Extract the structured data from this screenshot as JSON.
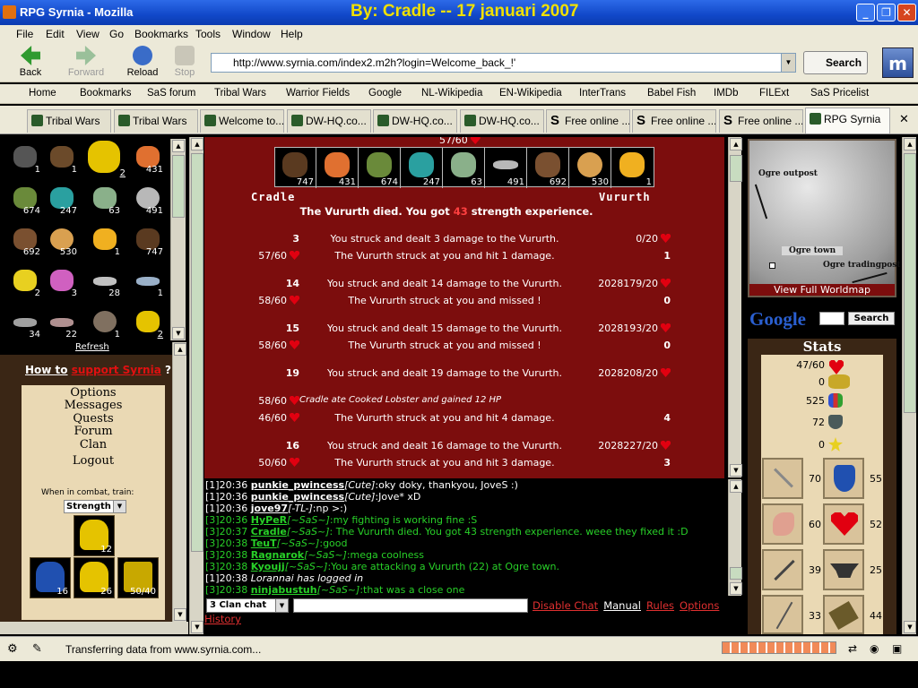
{
  "window": {
    "title": "RPG Syrnia - Mozilla",
    "signature": "By: Cradle  -- 17 januari 2007"
  },
  "menu": [
    "File",
    "Edit",
    "View",
    "Go",
    "Bookmarks",
    "Tools",
    "Window",
    "Help"
  ],
  "toolbar": {
    "back": "Back",
    "forward": "Forward",
    "reload": "Reload",
    "stop": "Stop",
    "url": "http://www.syrnia.com/index2.m2h?login=Welcome_back_!'",
    "search": "Search"
  },
  "bookmarks": [
    "Home",
    "Bookmarks",
    "SaS forum",
    "Tribal Wars",
    "Warrior Fields",
    "Google",
    "NL-Wikipedia",
    "EN-Wikipedia",
    "InterTrans",
    "Babel Fish",
    "IMDb",
    "FILExt",
    "SaS Pricelist"
  ],
  "tabs": [
    "Tribal Wars",
    "Tribal Wars",
    "Welcome to...",
    "DW-HQ.co...",
    "DW-HQ.co...",
    "DW-HQ.co...",
    "Free online ...",
    "Free online ...",
    "Free online ...",
    "RPG Syrnia"
  ],
  "inventory": [
    "1",
    "1",
    "2",
    "431",
    "674",
    "247",
    "63",
    "491",
    "692",
    "530",
    "1",
    "747",
    "2",
    "3",
    "28",
    "1",
    "34",
    "22",
    "1",
    "2"
  ],
  "left": {
    "refresh": "Refresh",
    "howto_a": "How to",
    "howto_b": "support Syrnia",
    "howto_c": "?",
    "menu": [
      "Options",
      "Messages",
      "Quests",
      "Forum",
      "Clan",
      "Logout"
    ],
    "train_label": "When in combat, train:",
    "train_value": "Strength",
    "equip": [
      "12",
      "16",
      "26",
      "50/40"
    ]
  },
  "combat": {
    "hp_top": "57/60",
    "foe_items": [
      "747",
      "431",
      "674",
      "247",
      "63",
      "491",
      "692",
      "530",
      "1"
    ],
    "player": "Cradle",
    "enemy": "Vururth",
    "died_a": "The Vururth died. You got",
    "died_xp": "43",
    "died_b": "strength experience.",
    "rows": [
      {
        "l": "3",
        "c": "You struck and dealt 3 damage to the Vururth.",
        "r": "0/20"
      },
      {
        "l": "57/60",
        "c": "The Vururth struck at you and hit 1 damage.",
        "r": "1"
      },
      {
        "l": "14",
        "c": "You struck and dealt 14 damage to the Vururth.",
        "r": "2028179/20"
      },
      {
        "l": "58/60",
        "c": "The Vururth struck at you and missed !",
        "r": "0"
      },
      {
        "l": "15",
        "c": "You struck and dealt 15 damage to the Vururth.",
        "r": "2028193/20"
      },
      {
        "l": "58/60",
        "c": "The Vururth struck at you and missed !",
        "r": "0"
      },
      {
        "l": "19",
        "c": "You struck and dealt 19 damage to the Vururth.",
        "r": "2028208/20"
      },
      {
        "l": "58/60",
        "c": "Cradle ate Cooked Lobster and gained 12 HP",
        "r": ""
      },
      {
        "l": "46/60",
        "c": "The Vururth struck at you and hit 4 damage.",
        "r": "4"
      },
      {
        "l": "16",
        "c": "You struck and dealt 16 damage to the Vururth.",
        "r": "2028227/20"
      },
      {
        "l": "50/60",
        "c": "The Vururth struck at you and hit 3 damage.",
        "r": "3"
      }
    ]
  },
  "chat": [
    {
      "pre": "[1]20:36 ",
      "name": "punkie_pwincess",
      "tag": "[Cute]",
      "msg": ":oky doky, thankyou, JoveS :)",
      "color": "white"
    },
    {
      "pre": "[1]20:36 ",
      "name": "punkie_pwincess",
      "tag": "[Cute]",
      "msg": ":Jove* xD",
      "color": "white"
    },
    {
      "pre": "[1]20:36 ",
      "name": "jove97",
      "tag": "[-TL-]",
      "msg": ":np >:)",
      "color": "white"
    },
    {
      "pre": "[3]20:36 ",
      "name": "HyPeR",
      "tag": "[~SaS~]",
      "msg": ":my fighting is working fine :S",
      "color": "green"
    },
    {
      "pre": "[3]20:37 ",
      "name": "Cradle",
      "tag": "[~SaS~]",
      "msg": ": The Vururth died. You got 43 strength experience. weee they fixed it :D",
      "color": "green"
    },
    {
      "pre": "[3]20:38 ",
      "name": "TeuT",
      "tag": "[~SaS~]",
      "msg": ":good",
      "color": "green"
    },
    {
      "pre": "[3]20:38 ",
      "name": "Ragnarok",
      "tag": "[~SaS~]",
      "msg": ":mega coolness",
      "color": "green"
    },
    {
      "pre": "[3]20:38 ",
      "name": "Kyoujj",
      "tag": "[~SaS~]",
      "msg": ":You are attacking a Vururth (22) at Ogre town.",
      "color": "green"
    },
    {
      "pre": "[1]20:38 ",
      "name": "",
      "tag": "",
      "msg": "Lorannai has logged in",
      "color": "white"
    },
    {
      "pre": "[3]20:38 ",
      "name": "ninjabustuh",
      "tag": "[~SaS~]",
      "msg": ":that was a close one",
      "color": "green"
    }
  ],
  "chatbar": {
    "channel": "3 Clan chat",
    "disable": "Disable Chat",
    "manual": "Manual",
    "rules": "Rules",
    "options": "Options",
    "history": "History"
  },
  "map": {
    "outpost": "Ogre outpost",
    "town": "Ogre town",
    "trading": "Ogre tradingpost",
    "link": "View Full Worldmap"
  },
  "google": {
    "logo": "Google",
    "button": "Search"
  },
  "stats": {
    "title": "Stats",
    "hp": "47/60",
    "gold": "0",
    "level": "525",
    "fame": "72",
    "stars": "0",
    "skills": [
      "70",
      "55",
      "60",
      "52",
      "39",
      "25",
      "33",
      "44"
    ]
  },
  "status": "Transferring data from www.syrnia.com..."
}
